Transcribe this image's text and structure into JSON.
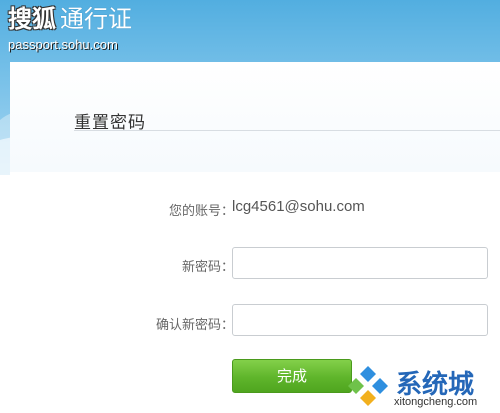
{
  "brand": {
    "name": "搜狐",
    "product": "通行证",
    "domain": "passport.sohu.com"
  },
  "page_title": "重置密码",
  "form": {
    "account": {
      "label": "您的账号：",
      "value": "lcg4561@sohu.com"
    },
    "new_password": {
      "label": "新密码：",
      "value": ""
    },
    "confirm_password": {
      "label": "确认新密码：",
      "value": ""
    },
    "submit_label": "完成"
  },
  "watermark": {
    "text": "系统城",
    "url": "xitongcheng.com"
  },
  "colors": {
    "sky": "#52aee0",
    "button": "#5fb52b",
    "watermark_text": "#2467b8"
  }
}
